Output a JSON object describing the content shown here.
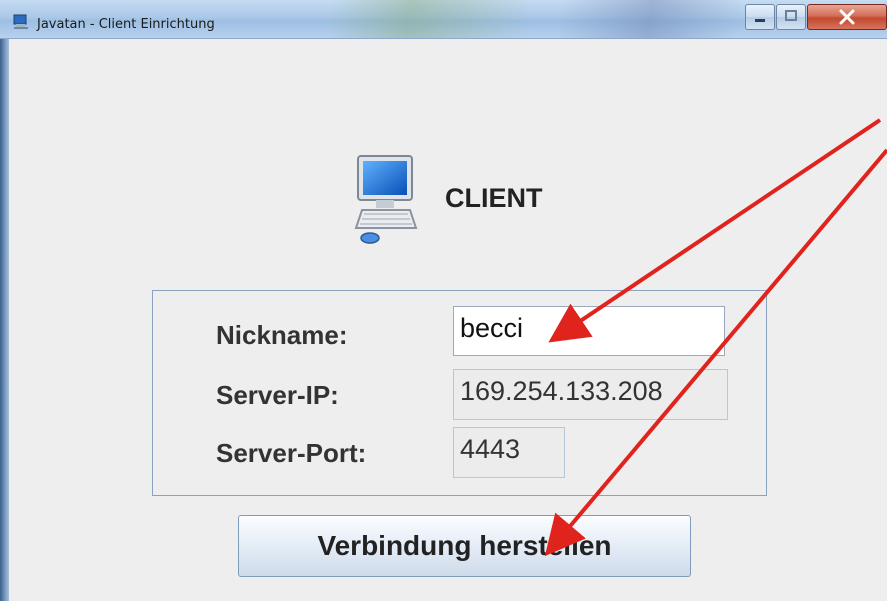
{
  "window": {
    "title": "Javatan - Client Einrichtung"
  },
  "header": {
    "label": "CLIENT",
    "icon": "computer-icon"
  },
  "form": {
    "nickname_label": "Nickname:",
    "nickname_value": "becci",
    "server_ip_label": "Server-IP:",
    "server_ip_value": "169.254.133.208",
    "server_port_label": "Server-Port:",
    "server_port_value": "4443"
  },
  "actions": {
    "connect_label": "Verbindung herstellen"
  },
  "annotation_color": "#e0231c"
}
